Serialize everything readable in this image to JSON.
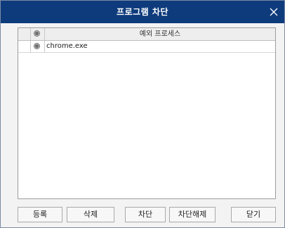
{
  "window": {
    "title": "프로그램 차단",
    "close_glyph": "×"
  },
  "list": {
    "header_label": "예외 프로세스",
    "rows": [
      {
        "label": "chrome.exe"
      }
    ]
  },
  "buttons": {
    "register": "등록",
    "delete": "삭제",
    "block": "차단",
    "unblock": "차단해제",
    "close": "닫기"
  },
  "colors": {
    "titlebar": "#0e3b7c",
    "window_bg": "#f3f3f3"
  }
}
